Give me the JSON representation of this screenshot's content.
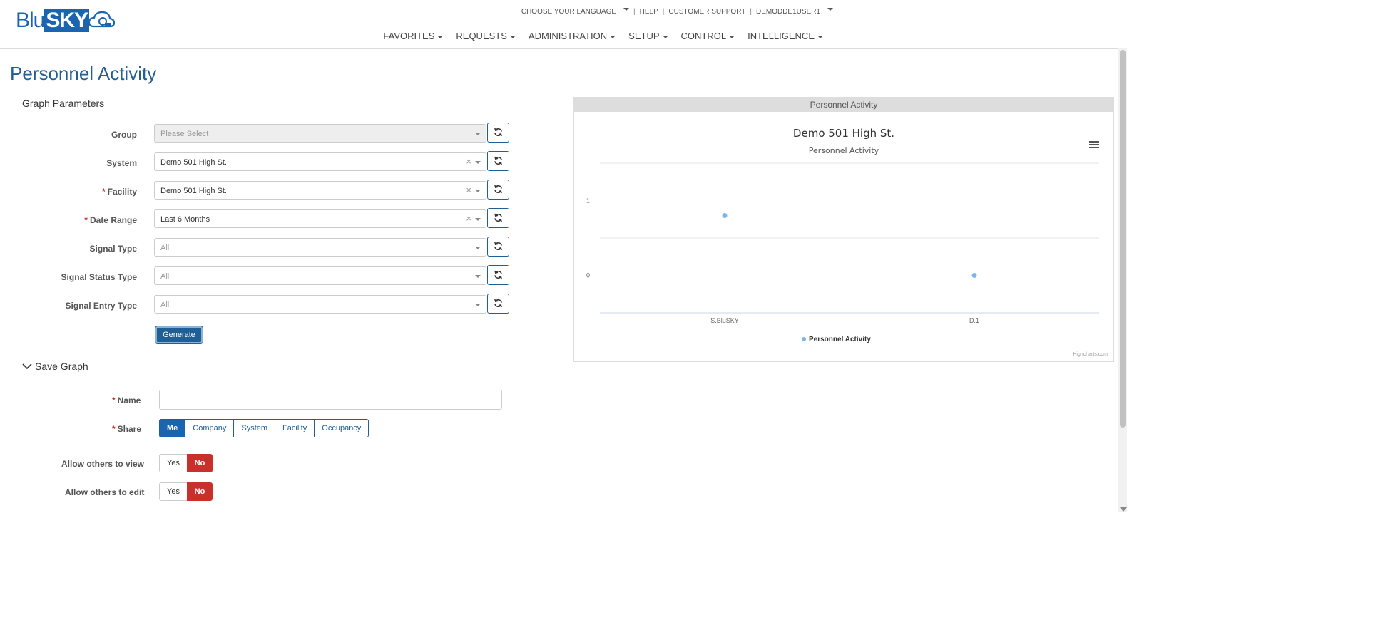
{
  "header": {
    "logo": {
      "blu": "Blu",
      "sky": "SKY"
    },
    "top_links": [
      {
        "label": "CHOOSE YOUR LANGUAGE",
        "dropdown": true
      },
      {
        "label": "HELP",
        "dropdown": false
      },
      {
        "label": "CUSTOMER SUPPORT",
        "dropdown": false
      },
      {
        "label": "DEMODDE1USER1",
        "dropdown": true
      }
    ],
    "nav": [
      "FAVORITES",
      "REQUESTS",
      "ADMINISTRATION",
      "SETUP",
      "CONTROL",
      "INTELLIGENCE"
    ]
  },
  "page": {
    "title": "Personnel Activity"
  },
  "params": {
    "title": "Graph Parameters",
    "fields": [
      {
        "label": "Group",
        "required": false,
        "value": "Please Select",
        "placeholder": true,
        "clearable": false,
        "disabled": true
      },
      {
        "label": "System",
        "required": false,
        "value": "Demo 501 High St.",
        "placeholder": false,
        "clearable": true,
        "disabled": false
      },
      {
        "label": "Facility",
        "required": true,
        "value": "Demo 501 High St.",
        "placeholder": false,
        "clearable": true,
        "disabled": false
      },
      {
        "label": "Date Range",
        "required": true,
        "value": "Last 6 Months",
        "placeholder": false,
        "clearable": true,
        "disabled": false
      },
      {
        "label": "Signal Type",
        "required": false,
        "value": "All",
        "placeholder": true,
        "clearable": false,
        "disabled": false
      },
      {
        "label": "Signal Status Type",
        "required": false,
        "value": "All",
        "placeholder": true,
        "clearable": false,
        "disabled": false
      },
      {
        "label": "Signal Entry Type",
        "required": false,
        "value": "All",
        "placeholder": true,
        "clearable": false,
        "disabled": false
      }
    ],
    "generate_label": "Generate"
  },
  "save": {
    "title": "Save Graph",
    "name_label": "Name",
    "share_label": "Share",
    "share_options": [
      "Me",
      "Company",
      "System",
      "Facility",
      "Occupancy"
    ],
    "share_selected": "Me",
    "view_label": "Allow others to view",
    "edit_label": "Allow others to edit",
    "yes": "Yes",
    "no": "No",
    "view_value": "No",
    "edit_value": "No"
  },
  "chart_panel": {
    "heading": "Personnel Activity"
  },
  "chart_data": {
    "type": "scatter",
    "title": "Demo 501 High St.",
    "subtitle": "Personnel Activity",
    "categories": [
      "S.BluSKY",
      "D.1"
    ],
    "series": [
      {
        "name": "Personnel Activity",
        "values": [
          0.8,
          0
        ]
      }
    ],
    "yticks": [
      1,
      0
    ],
    "ylim": [
      -0.5,
      1.5
    ],
    "grid": true,
    "legend": "bottom-center",
    "credits": "Highcharts.com",
    "color": "#7cb5ec"
  },
  "colors": {
    "brand": "#1a64b0",
    "danger": "#c9302c",
    "title": "#1f5f96"
  }
}
